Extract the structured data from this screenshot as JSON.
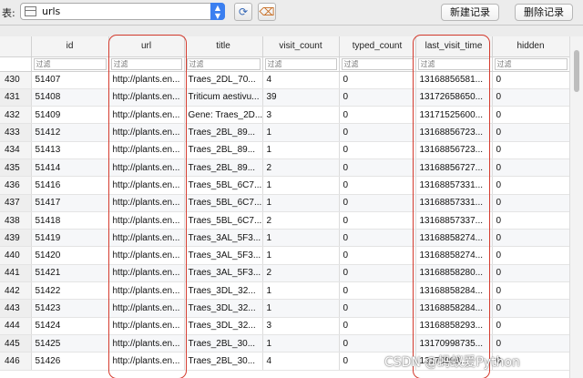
{
  "toolbar": {
    "table_label": "表:",
    "table_name": "urls",
    "refresh_icon": "refresh-icon",
    "clear_filter_icon": "clear-filter-icon",
    "new_record": "新建记录",
    "delete_record": "删除记录"
  },
  "columns": [
    "",
    "id",
    "url",
    "title",
    "visit_count",
    "typed_count",
    "last_visit_time",
    "hidden"
  ],
  "filter_placeholder": "过滤",
  "rows": [
    [
      "430",
      "51407",
      "http://plants.en...",
      "Traes_2DL_70...",
      "4",
      "0",
      "13168856581...",
      "0"
    ],
    [
      "431",
      "51408",
      "http://plants.en...",
      "Triticum aestivu...",
      "39",
      "0",
      "13172658650...",
      "0"
    ],
    [
      "432",
      "51409",
      "http://plants.en...",
      "Gene: Traes_2D...",
      "3",
      "0",
      "13171525600...",
      "0"
    ],
    [
      "433",
      "51412",
      "http://plants.en...",
      "Traes_2BL_89...",
      "1",
      "0",
      "13168856723...",
      "0"
    ],
    [
      "434",
      "51413",
      "http://plants.en...",
      "Traes_2BL_89...",
      "1",
      "0",
      "13168856723...",
      "0"
    ],
    [
      "435",
      "51414",
      "http://plants.en...",
      "Traes_2BL_89...",
      "2",
      "0",
      "13168856727...",
      "0"
    ],
    [
      "436",
      "51416",
      "http://plants.en...",
      "Traes_5BL_6C7...",
      "1",
      "0",
      "13168857331...",
      "0"
    ],
    [
      "437",
      "51417",
      "http://plants.en...",
      "Traes_5BL_6C7...",
      "1",
      "0",
      "13168857331...",
      "0"
    ],
    [
      "438",
      "51418",
      "http://plants.en...",
      "Traes_5BL_6C7...",
      "2",
      "0",
      "13168857337...",
      "0"
    ],
    [
      "439",
      "51419",
      "http://plants.en...",
      "Traes_3AL_5F3...",
      "1",
      "0",
      "13168858274...",
      "0"
    ],
    [
      "440",
      "51420",
      "http://plants.en...",
      "Traes_3AL_5F3...",
      "1",
      "0",
      "13168858274...",
      "0"
    ],
    [
      "441",
      "51421",
      "http://plants.en...",
      "Traes_3AL_5F3...",
      "2",
      "0",
      "13168858280...",
      "0"
    ],
    [
      "442",
      "51422",
      "http://plants.en...",
      "Traes_3DL_32...",
      "1",
      "0",
      "13168858284...",
      "0"
    ],
    [
      "443",
      "51423",
      "http://plants.en...",
      "Traes_3DL_32...",
      "1",
      "0",
      "13168858284...",
      "0"
    ],
    [
      "444",
      "51424",
      "http://plants.en...",
      "Traes_3DL_32...",
      "3",
      "0",
      "13168858293...",
      "0"
    ],
    [
      "445",
      "51425",
      "http://plants.en...",
      "Traes_2BL_30...",
      "1",
      "0",
      "13170998735...",
      "0"
    ],
    [
      "446",
      "51426",
      "http://plants.en...",
      "Traes_2BL_30...",
      "4",
      "0",
      "13170998...",
      "0"
    ]
  ],
  "watermark": "CSDN @蚂蚁爱Python",
  "colors": {
    "highlight": "#d43c2f",
    "dropdown_accent": "#3b7ff0"
  }
}
